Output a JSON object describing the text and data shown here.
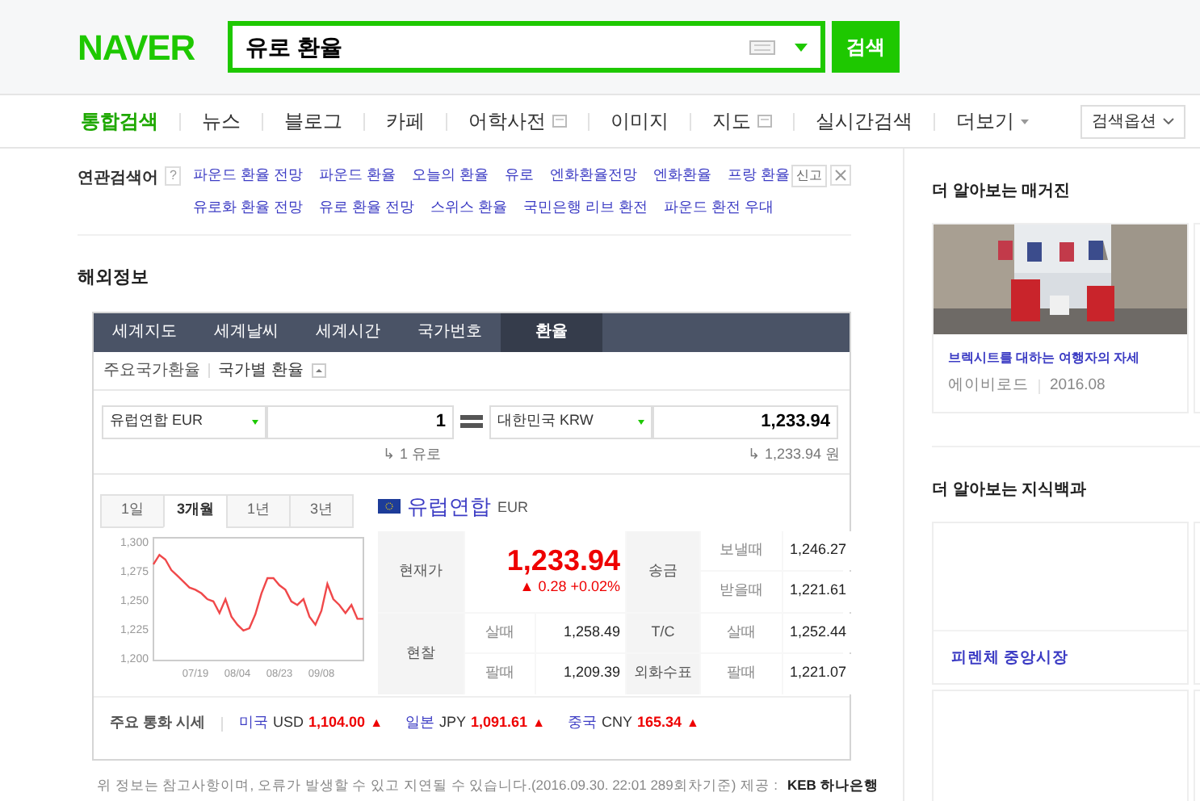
{
  "header": {
    "logo": "NAVER",
    "search": {
      "value": "유로 환율"
    },
    "button": "검색"
  },
  "nav": {
    "items": [
      {
        "label": "통합검색",
        "selected": true,
        "kind": "plain"
      },
      {
        "label": "뉴스",
        "selected": false,
        "kind": "plain"
      },
      {
        "label": "블로그",
        "selected": false,
        "kind": "plain"
      },
      {
        "label": "카페",
        "selected": false,
        "kind": "plain"
      },
      {
        "label": "어학사전",
        "selected": false,
        "kind": "popup"
      },
      {
        "label": "이미지",
        "selected": false,
        "kind": "plain"
      },
      {
        "label": "지도",
        "selected": false,
        "kind": "popup"
      },
      {
        "label": "실시간검색",
        "selected": false,
        "kind": "plain"
      },
      {
        "label": "더보기",
        "selected": false,
        "kind": "more"
      }
    ],
    "options": "검색옵션"
  },
  "related": {
    "title": "연관검색어",
    "help": "?",
    "links": [
      "파운드 환율 전망",
      "파운드 환율",
      "오늘의 환율",
      "유로",
      "엔화환율전망",
      "엔화환율",
      "프랑 환율",
      "유로화 환율 전망",
      "유로 환율 전망",
      "스위스 환율",
      "국민은행 리브 환전",
      "파운드 환전 우대"
    ],
    "report": "신고"
  },
  "section_title": "해외정보",
  "widget": {
    "tabs": [
      {
        "label": "세계지도",
        "selected": false
      },
      {
        "label": "세계날씨",
        "selected": false
      },
      {
        "label": "세계시간",
        "selected": false
      },
      {
        "label": "국가번호",
        "selected": false
      },
      {
        "label": "환율",
        "selected": true
      }
    ],
    "subtabs": [
      "주요국가환율",
      "국가별 환율"
    ],
    "converter": {
      "from": {
        "currency": "유럽연합 EUR",
        "amount": "1",
        "note": "↳ 1 유로"
      },
      "to": {
        "currency": "대한민국 KRW",
        "amount": "1,233.94",
        "note": "↳ 1,233.94 원"
      }
    },
    "periods": [
      {
        "label": "1일",
        "selected": false
      },
      {
        "label": "3개월",
        "selected": true
      },
      {
        "label": "1년",
        "selected": false
      },
      {
        "label": "3년",
        "selected": false
      }
    ],
    "chart_data": {
      "type": "line",
      "categories": [
        null,
        null,
        null,
        null,
        null,
        null,
        null,
        "07/19",
        null,
        null,
        null,
        null,
        null,
        null,
        "08/04",
        null,
        null,
        null,
        null,
        null,
        null,
        "08/23",
        null,
        null,
        null,
        null,
        null,
        null,
        "09/08",
        null,
        null,
        null,
        null,
        null,
        null,
        null
      ],
      "series": [
        {
          "color": "#f0484a",
          "values": [
            1280,
            1288,
            1284,
            1275,
            1270,
            1265,
            1260,
            1258,
            1255,
            1250,
            1248,
            1238,
            1250,
            1235,
            1228,
            1223,
            1225,
            1237,
            1255,
            1268,
            1268,
            1262,
            1258,
            1248,
            1245,
            1250,
            1235,
            1228,
            1240,
            1263,
            1250,
            1245,
            1238,
            1245,
            1233,
            1233
          ]
        }
      ],
      "ylim": [
        1200,
        1300
      ],
      "yticks": [
        {
          "value": 1200,
          "label": "1,200"
        },
        {
          "value": 1225,
          "label": "1,225"
        },
        {
          "value": 1250,
          "label": "1,250"
        },
        {
          "value": 1275,
          "label": "1,275"
        },
        {
          "value": 1300,
          "label": "1,300"
        }
      ]
    },
    "country": {
      "name": "유럽연합",
      "code": "EUR"
    },
    "quote": {
      "current_label": "현재가",
      "price": "1,233.94",
      "change": "▲ 0.28 +0.02%",
      "remit_label": "송금",
      "send_label": "보낼때",
      "send": "1,246.27",
      "receive_label": "받을때",
      "receive": "1,221.61",
      "cash_label": "현찰",
      "cash_buy_label": "살때",
      "cash_buy": "1,258.49",
      "cash_sell_label": "팔때",
      "cash_sell": "1,209.39",
      "tc_label": "T/C",
      "tc_buy_label": "살때",
      "tc_buy": "1,252.44",
      "check_label": "외화수표",
      "check_sell_label": "팔때",
      "check_sell": "1,221.07"
    },
    "major": {
      "label": "주요 통화 시세",
      "items": [
        {
          "country": "미국",
          "code": "USD",
          "value": "1,104.00",
          "arrow": "▲"
        },
        {
          "country": "일본",
          "code": "JPY",
          "value": "1,091.61",
          "arrow": "▲"
        },
        {
          "country": "중국",
          "code": "CNY",
          "value": "165.34",
          "arrow": "▲"
        }
      ]
    }
  },
  "notice": {
    "text": "위 정보는 참고사항이며, 오류가 발생할 수 있고 지연될 수 있습니다.(2016.09.30. 22:01 289회차기준)",
    "provider": "제공 :",
    "bank": "KEB 하나은행"
  },
  "sidebar": {
    "magazine": {
      "title": "더 알아보는 매거진",
      "card": {
        "kind": "picture",
        "title": "브렉시트를 대하는 여행자의 자세",
        "source": "에이비로드",
        "date": "2016.08"
      }
    },
    "encyclopedia": {
      "title": "더 알아보는 지식백과",
      "card": {
        "title": "피렌체 중앙시장"
      }
    }
  }
}
